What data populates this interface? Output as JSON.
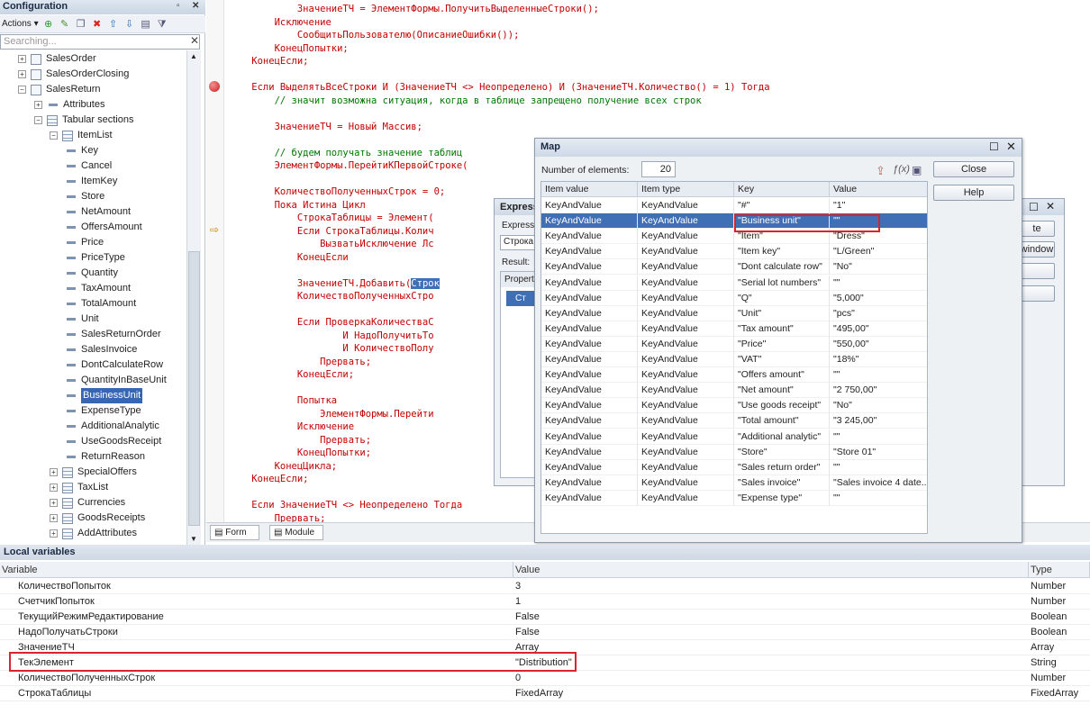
{
  "config": {
    "title": "Configuration",
    "actions_label": "Actions",
    "search_placeholder": "Searching...",
    "tree": [
      {
        "label": "SalesOrder",
        "level": 1,
        "exp": "+",
        "icon": "doc"
      },
      {
        "label": "SalesOrderClosing",
        "level": 1,
        "exp": "+",
        "icon": "doc"
      },
      {
        "label": "SalesReturn",
        "level": 1,
        "exp": "−",
        "icon": "doc"
      },
      {
        "label": "Attributes",
        "level": 2,
        "exp": "+",
        "icon": "attr"
      },
      {
        "label": "Tabular sections",
        "level": 2,
        "exp": "−",
        "icon": "table"
      },
      {
        "label": "ItemList",
        "level": 3,
        "exp": "−",
        "icon": "table"
      },
      {
        "label": "Key",
        "level": 4,
        "icon": "attr"
      },
      {
        "label": "Cancel",
        "level": 4,
        "icon": "attr"
      },
      {
        "label": "ItemKey",
        "level": 4,
        "icon": "attr"
      },
      {
        "label": "Store",
        "level": 4,
        "icon": "attr"
      },
      {
        "label": "NetAmount",
        "level": 4,
        "icon": "attr"
      },
      {
        "label": "OffersAmount",
        "level": 4,
        "icon": "attr"
      },
      {
        "label": "Price",
        "level": 4,
        "icon": "attr"
      },
      {
        "label": "PriceType",
        "level": 4,
        "icon": "attr"
      },
      {
        "label": "Quantity",
        "level": 4,
        "icon": "attr"
      },
      {
        "label": "TaxAmount",
        "level": 4,
        "icon": "attr"
      },
      {
        "label": "TotalAmount",
        "level": 4,
        "icon": "attr"
      },
      {
        "label": "Unit",
        "level": 4,
        "icon": "attr"
      },
      {
        "label": "SalesReturnOrder",
        "level": 4,
        "icon": "attr"
      },
      {
        "label": "SalesInvoice",
        "level": 4,
        "icon": "attr"
      },
      {
        "label": "DontCalculateRow",
        "level": 4,
        "icon": "attr"
      },
      {
        "label": "QuantityInBaseUnit",
        "level": 4,
        "icon": "attr"
      },
      {
        "label": "BusinessUnit",
        "level": 4,
        "icon": "attr",
        "selected": true
      },
      {
        "label": "ExpenseType",
        "level": 4,
        "icon": "attr"
      },
      {
        "label": "AdditionalAnalytic",
        "level": 4,
        "icon": "attr"
      },
      {
        "label": "UseGoodsReceipt",
        "level": 4,
        "icon": "attr"
      },
      {
        "label": "ReturnReason",
        "level": 4,
        "icon": "attr"
      },
      {
        "label": "SpecialOffers",
        "level": 3,
        "exp": "+",
        "icon": "table"
      },
      {
        "label": "TaxList",
        "level": 3,
        "exp": "+",
        "icon": "table"
      },
      {
        "label": "Currencies",
        "level": 3,
        "exp": "+",
        "icon": "table"
      },
      {
        "label": "GoodsReceipts",
        "level": 3,
        "exp": "+",
        "icon": "table"
      },
      {
        "label": "AddAttributes",
        "level": 3,
        "exp": "+",
        "icon": "table"
      }
    ]
  },
  "code": {
    "lines": [
      {
        "t": "            ЗначениеТЧ = ЭлементФормы.ПолучитьВыделенныеСтроки();"
      },
      {
        "t": "        Исключение"
      },
      {
        "t": "            СообщитьПользователю(ОписаниеОшибки());"
      },
      {
        "t": "        КонецПопытки;"
      },
      {
        "t": "    КонецЕсли;"
      },
      {
        "t": ""
      },
      {
        "t": "    Если ВыделятьВсеСтроки И (ЗначениеТЧ <> Неопределено) И (ЗначениеТЧ.Количество() = 1) Тогда"
      },
      {
        "t": "        // значит возможна ситуация, когда в таблице запрещено получение всех строк",
        "c": true
      },
      {
        "t": ""
      },
      {
        "t": "        ЗначениеТЧ = Новый Массив;"
      },
      {
        "t": ""
      },
      {
        "t": "        // будем получать значение таблиц",
        "c": true
      },
      {
        "t": "        ЭлементФормы.ПерейтиКПервойСтроке("
      },
      {
        "t": ""
      },
      {
        "t": "        КоличествоПолученныхСтрок = 0;"
      },
      {
        "t": "        Пока Истина Цикл"
      },
      {
        "t": "            СтрокаТаблицы = Элемент("
      },
      {
        "t": "            Если СтрокаТаблицы.Колич"
      },
      {
        "t": "                ВызватьИсключение Лс"
      },
      {
        "t": "            КонецЕсли"
      },
      {
        "t": ""
      },
      {
        "t": "            ЗначениеТЧ.Добавить(",
        "h": "Строк"
      },
      {
        "t": "            КоличествоПолученныхСтро"
      },
      {
        "t": ""
      },
      {
        "t": "            Если ПроверкаКоличестваС"
      },
      {
        "t": "                    И НадоПолучитьТо"
      },
      {
        "t": "                    И КоличествоПолу"
      },
      {
        "t": "                Прервать;"
      },
      {
        "t": "            КонецЕсли;"
      },
      {
        "t": ""
      },
      {
        "t": "            Попытка"
      },
      {
        "t": "                ЭлементФормы.Перейти"
      },
      {
        "t": "            Исключение"
      },
      {
        "t": "                Прервать;"
      },
      {
        "t": "            КонецПопытки;"
      },
      {
        "t": "        КонецЦикла;"
      },
      {
        "t": "    КонецЕсли;"
      },
      {
        "t": ""
      },
      {
        "t": "    Если ЗначениеТЧ <> Неопределено Тогда"
      },
      {
        "t": "        Прервать;"
      }
    ],
    "tabs": [
      "Form",
      "Module"
    ]
  },
  "expr": {
    "title": "Express",
    "expression_label": "Expressi",
    "expression_value": "Строка",
    "result_label": "Result:",
    "props_header": "Propert",
    "selected_row": "Ст",
    "btn1": "te",
    "btn2": "window"
  },
  "map": {
    "title": "Map",
    "count_label": "Number of elements:",
    "count_value": "20",
    "close_label": "Close",
    "help_label": "Help",
    "columns": [
      "Item value",
      "Item type",
      "Key",
      "Value"
    ],
    "rows": [
      [
        "KeyAndValue",
        "KeyAndValue",
        "\"#\"",
        "\"1\""
      ],
      [
        "KeyAndValue",
        "KeyAndValue",
        "\"Business unit\"",
        "\"\""
      ],
      [
        "KeyAndValue",
        "KeyAndValue",
        "\"Item\"",
        "\"Dress\""
      ],
      [
        "KeyAndValue",
        "KeyAndValue",
        "\"Item key\"",
        "\"L/Green\""
      ],
      [
        "KeyAndValue",
        "KeyAndValue",
        "\"Dont calculate row\"",
        "\"No\""
      ],
      [
        "KeyAndValue",
        "KeyAndValue",
        "\"Serial lot numbers\"",
        "\"\""
      ],
      [
        "KeyAndValue",
        "KeyAndValue",
        "\"Q\"",
        "\"5,000\""
      ],
      [
        "KeyAndValue",
        "KeyAndValue",
        "\"Unit\"",
        "\"pcs\""
      ],
      [
        "KeyAndValue",
        "KeyAndValue",
        "\"Tax amount\"",
        "\"495,00\""
      ],
      [
        "KeyAndValue",
        "KeyAndValue",
        "\"Price\"",
        "\"550,00\""
      ],
      [
        "KeyAndValue",
        "KeyAndValue",
        "\"VAT\"",
        "\"18%\""
      ],
      [
        "KeyAndValue",
        "KeyAndValue",
        "\"Offers amount\"",
        "\"\""
      ],
      [
        "KeyAndValue",
        "KeyAndValue",
        "\"Net amount\"",
        "\"2 750,00\""
      ],
      [
        "KeyAndValue",
        "KeyAndValue",
        "\"Use goods receipt\"",
        "\"No\""
      ],
      [
        "KeyAndValue",
        "KeyAndValue",
        "\"Total amount\"",
        "\"3 245,00\""
      ],
      [
        "KeyAndValue",
        "KeyAndValue",
        "\"Additional analytic\"",
        "\"\""
      ],
      [
        "KeyAndValue",
        "KeyAndValue",
        "\"Store\"",
        "\"Store 01\""
      ],
      [
        "KeyAndValue",
        "KeyAndValue",
        "\"Sales return order\"",
        "\"\""
      ],
      [
        "KeyAndValue",
        "KeyAndValue",
        "\"Sales invoice\"",
        "\"Sales invoice 4 date..."
      ],
      [
        "KeyAndValue",
        "KeyAndValue",
        "\"Expense type\"",
        "\"\""
      ]
    ]
  },
  "locals": {
    "title": "Local variables",
    "columns": [
      "Variable",
      "Value",
      "Type"
    ],
    "rows": [
      [
        "КоличествоПопыток",
        "3",
        "Number"
      ],
      [
        "СчетчикПопыток",
        "1",
        "Number"
      ],
      [
        "ТекущийРежимРедактирование",
        "False",
        "Boolean"
      ],
      [
        "НадоПолучатьСтроки",
        "False",
        "Boolean"
      ],
      [
        "ЗначениеТЧ",
        "Array",
        "Array"
      ],
      [
        "ТекЭлемент",
        "\"Distribution\"",
        "String"
      ],
      [
        "КоличествоПолученныхСтрок",
        "0",
        "Number"
      ],
      [
        "СтрокаТаблицы",
        "FixedArray",
        "FixedArray"
      ]
    ]
  },
  "colors": {
    "accent": "#3766b5",
    "highlight": "#d6252c",
    "code": "#c20000",
    "comment": "#007700"
  }
}
